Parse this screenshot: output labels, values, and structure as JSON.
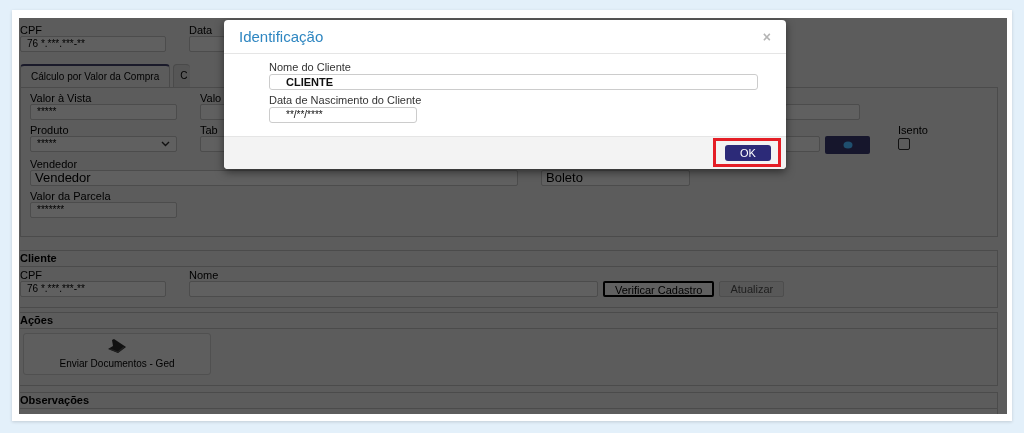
{
  "header_fields": [
    {
      "label": "CPF",
      "value": "76 *.***.***-**"
    },
    {
      "label": "Data"
    }
  ],
  "tabs": [
    {
      "label": "Cálculo por Valor da Compra",
      "selected": true
    },
    {
      "label": "C",
      "selected": false
    }
  ],
  "calc": {
    "cash_value": {
      "label": "Valor à Vista",
      "value": "*****"
    },
    "column_2_label_1": "Valo",
    "product": {
      "label": "Produto",
      "value": "*****"
    },
    "column_2_label_2": "Tab",
    "exempt": {
      "label": "Isento",
      "checked": false
    },
    "seller": {
      "label": "Vendedor",
      "value": "Vendedor"
    },
    "payment": {
      "value": "Boleto"
    },
    "installment": {
      "label": "Valor da Parcela",
      "value": "*******"
    }
  },
  "client": {
    "title": "Cliente",
    "cpf": {
      "label": "CPF",
      "value": "76 *.***.***-**"
    },
    "name": {
      "label": "Nome"
    },
    "buttons": [
      {
        "label": "Verificar Cadastro",
        "focused": true,
        "disabled": false
      },
      {
        "label": "Atualizar",
        "focused": false,
        "disabled": true
      }
    ]
  },
  "actions": {
    "title": "Ações",
    "items": [
      {
        "label": "Enviar Documentos - Ged"
      }
    ]
  },
  "notes": {
    "title": "Observações"
  },
  "dialog": {
    "title": "Identificação",
    "close": "×",
    "fields": [
      {
        "label": "Nome do Cliente",
        "value": "CLIENTE"
      },
      {
        "label": "Data de Nascimento do Cliente",
        "value": "**/**/****"
      }
    ],
    "ok_button": {
      "label": "OK",
      "highlighted": true
    }
  }
}
